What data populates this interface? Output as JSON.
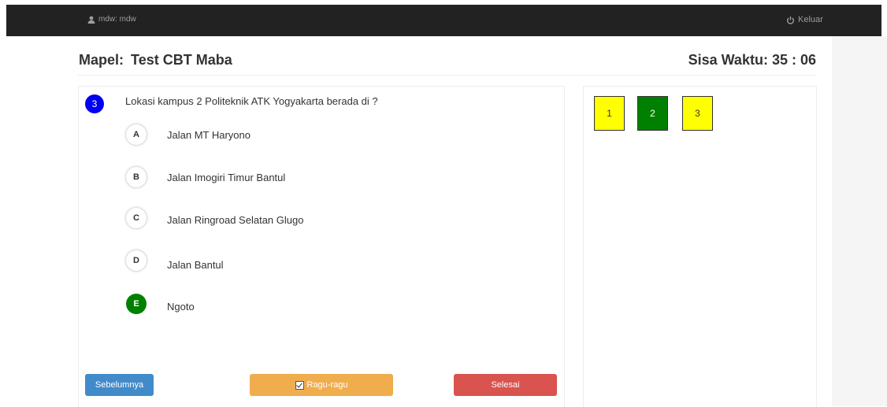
{
  "navbar": {
    "user_label": "mdw: mdw",
    "logout_label": "Keluar"
  },
  "header": {
    "mapel_prefix": "Mapel:",
    "mapel_name": "Test CBT Maba",
    "timer_label": "Sisa Waktu:",
    "timer_value": "35 : 06"
  },
  "question": {
    "number": "3",
    "text": "Lokasi kampus 2 Politeknik ATK Yogyakarta berada di ?",
    "options": [
      {
        "letter": "A",
        "text": "Jalan MT Haryono",
        "selected": false
      },
      {
        "letter": "B",
        "text": "Jalan Imogiri Timur Bantul",
        "selected": false
      },
      {
        "letter": "C",
        "text": "Jalan Ringroad Selatan Glugo",
        "selected": false
      },
      {
        "letter": "D",
        "text": "Jalan Bantul",
        "selected": false
      },
      {
        "letter": "E",
        "text": "Ngoto",
        "selected": true
      }
    ]
  },
  "buttons": {
    "prev_label": "Sebelumnya",
    "doubt_label": "Ragu-ragu",
    "finish_label": "Selesai"
  },
  "navigator": {
    "items": [
      {
        "label": "1",
        "status": "doubt",
        "color": "#ffff00"
      },
      {
        "label": "2",
        "status": "answered",
        "color": "#008000"
      },
      {
        "label": "3",
        "status": "doubt",
        "color": "#ffff00"
      }
    ]
  },
  "colors": {
    "navbar": "#222222",
    "question_badge": "#0000ee",
    "selected_option": "#008000",
    "prev_button": "#428bca",
    "doubt_button": "#f0ad4e",
    "finish_button": "#d9534f"
  }
}
